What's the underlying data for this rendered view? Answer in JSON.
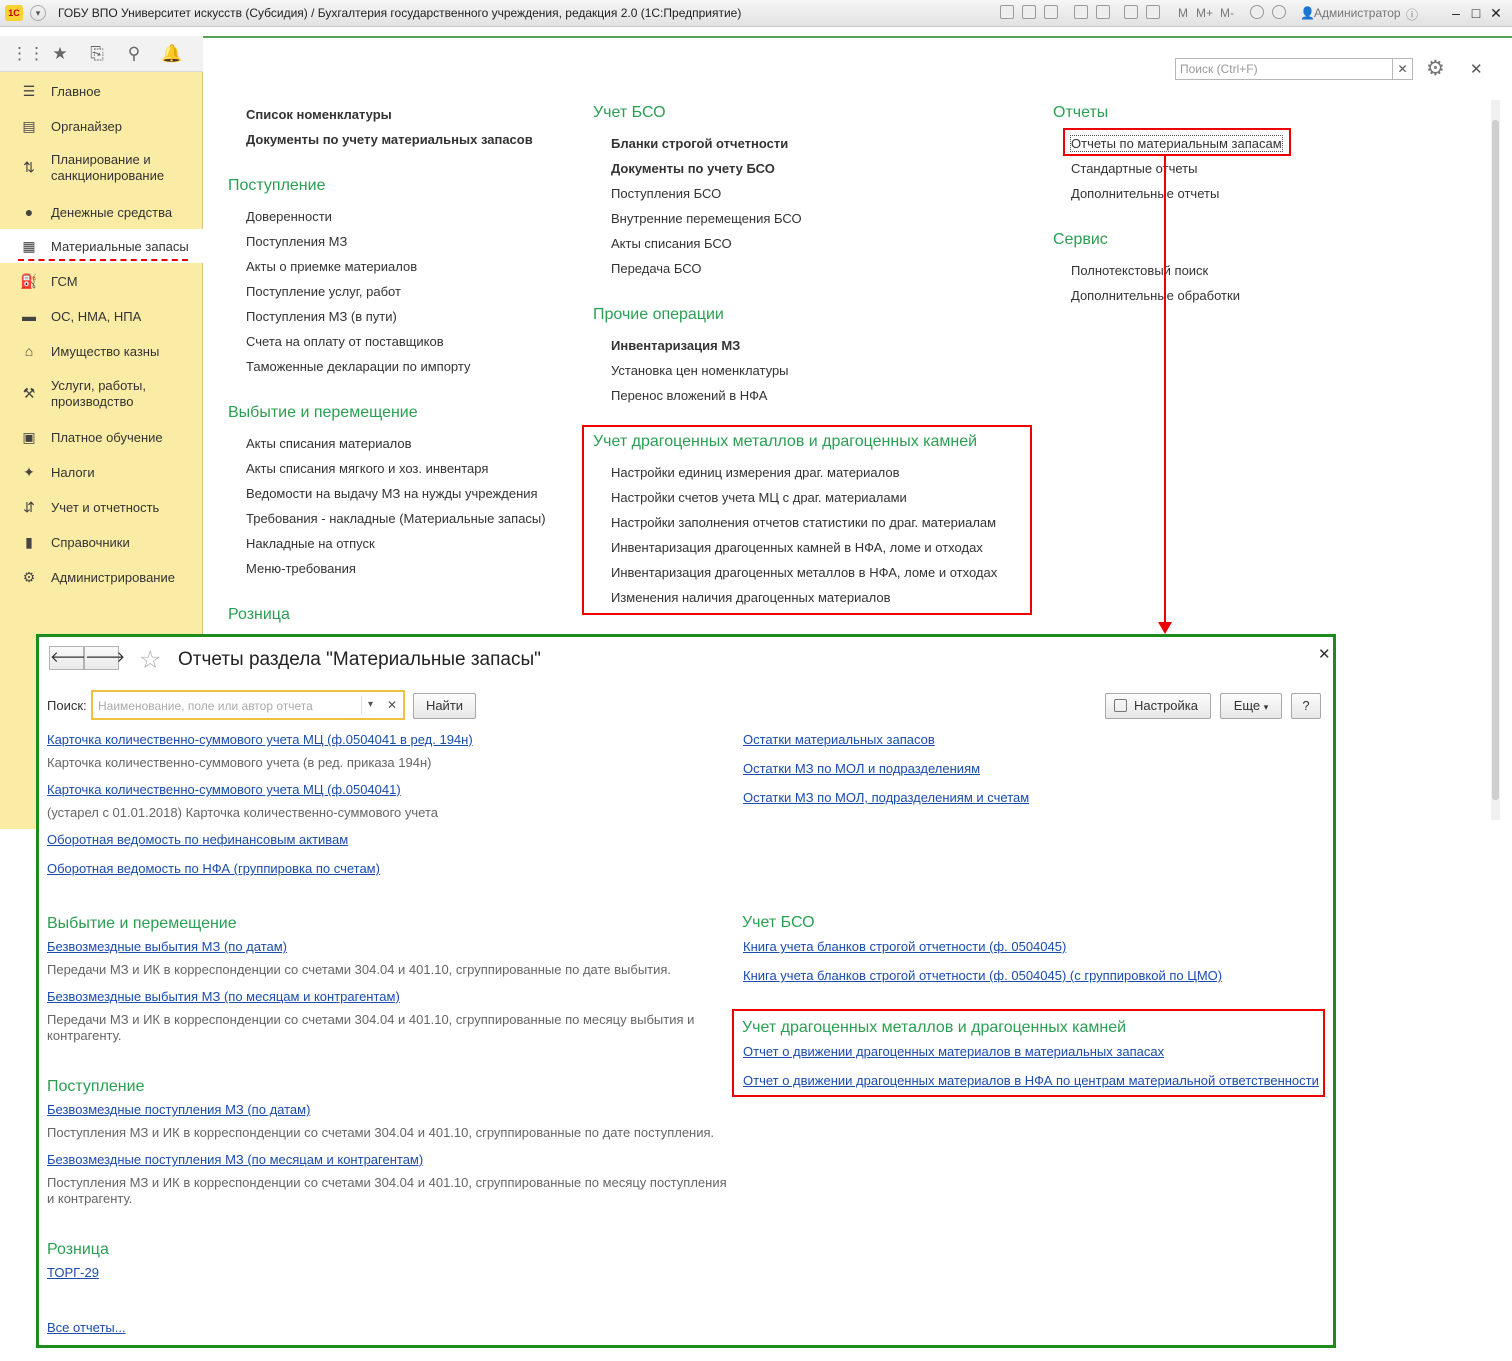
{
  "window": {
    "title": "ГОБУ ВПО Университет искусств (Субсидия) / Бухгалтерия государственного учреждения, редакция 2.0  (1С:Предприятие)",
    "user": "Администратор",
    "toolbar_labels": [
      "M",
      "M+",
      "M-"
    ]
  },
  "sidebar": {
    "items": [
      {
        "label": "Главное",
        "icon": "menu-icon"
      },
      {
        "label": "Органайзер",
        "icon": "organizer-icon"
      },
      {
        "label": "Планирование и\nсанкционирование",
        "icon": "planning-icon"
      },
      {
        "label": "Денежные средства",
        "icon": "money-icon"
      },
      {
        "label": "Материальные запасы",
        "icon": "grid-icon"
      },
      {
        "label": "ГСМ",
        "icon": "fuel-icon"
      },
      {
        "label": "ОС, НМА, НПА",
        "icon": "truck-icon"
      },
      {
        "label": "Имущество казны",
        "icon": "building-icon"
      },
      {
        "label": "Услуги, работы,\nпроизводство",
        "icon": "tools-icon"
      },
      {
        "label": "Платное обучение",
        "icon": "education-icon"
      },
      {
        "label": "Налоги",
        "icon": "eagle-icon"
      },
      {
        "label": "Учет и отчетность",
        "icon": "report-icon"
      },
      {
        "label": "Справочники",
        "icon": "book-icon"
      },
      {
        "label": "Администрирование",
        "icon": "gear-icon"
      }
    ]
  },
  "main": {
    "search_placeholder": "Поиск (Ctrl+F)",
    "col1": {
      "top": [
        "Список номенклатуры",
        "Документы по учету материальных запасов"
      ],
      "h1": "Поступление",
      "g1": [
        "Доверенности",
        "Поступления МЗ",
        "Акты о приемке материалов",
        "Поступление услуг, работ",
        "Поступления МЗ (в пути)",
        "Счета на оплату от поставщиков",
        "Таможенные декларации по импорту"
      ],
      "h2": "Выбытие и перемещение",
      "g2": [
        "Акты списания материалов",
        "Акты списания мягкого и хоз. инвентаря",
        "Ведомости на выдачу МЗ на нужды учреждения",
        "Требования - накладные (Материальные запасы)",
        "Накладные на отпуск",
        "Меню-требования"
      ],
      "h3": "Розница"
    },
    "col2": {
      "h1": "Учет БСО",
      "g1": [
        "Бланки строгой отчетности",
        "Документы по учету БСО",
        "Поступления БСО",
        "Внутренние перемещения БСО",
        "Акты списания БСО",
        "Передача БСО"
      ],
      "h2": "Прочие операции",
      "g2": [
        "Инвентаризация МЗ",
        "Установка цен номенклатуры",
        "Перенос вложений в НФА"
      ],
      "h3": "Учет драгоценных металлов и драгоценных камней",
      "g3": [
        "Настройки единиц измерения драг. материалов",
        "Настройки счетов учета МЦ с драг. материалами",
        "Настройки заполнения отчетов статистики по драг. материалам",
        "Инвентаризация драгоценных камней в НФА, ломе и отходах",
        "Инвентаризация драгоценных металлов в НФА, ломе и отходах",
        "Изменения наличия драгоценных материалов"
      ]
    },
    "col3": {
      "h1": "Отчеты",
      "g1": [
        "Отчеты по материальным запасам",
        "Стандартные отчеты",
        "Дополнительные отчеты"
      ],
      "h2": "Сервис",
      "g2": [
        "Полнотекстовый поиск",
        "Дополнительные обработки"
      ]
    }
  },
  "popup": {
    "title": "Отчеты раздела \"Материальные запасы\"",
    "search_label": "Поиск:",
    "search_placeholder": "Наименование, поле или автор отчета",
    "find_label": "Найти",
    "settings_label": "Настройка",
    "more_label": "Еще",
    "help_label": "?",
    "left": {
      "l1": "Карточка количественно-суммового учета МЦ  (ф.0504041 в ред. 194н)",
      "d1": "Карточка количественно-суммового учета (в ред. приказа 194н)",
      "l2": "Карточка количественно-суммового учета МЦ  (ф.0504041)",
      "d2": "(устарел с 01.01.2018) Карточка количественно-суммового учета",
      "l3": "Оборотная ведомость по нефинансовым активам",
      "l4": "Оборотная ведомость по НФА (группировка по счетам)",
      "h1": "Выбытие и перемещение",
      "l5": "Безвозмездные выбытия МЗ (по датам)",
      "d5": "Передачи МЗ и ИК в корреспонденции со счетами 304.04 и 401.10, сгруппированные по дате выбытия.",
      "l6": "Безвозмездные выбытия МЗ (по месяцам и контрагентам)",
      "d6a": "Передачи МЗ и ИК в корреспонденции со счетами 304.04 и 401.10, сгруппированные по месяцу выбытия и",
      "d6b": "контрагенту.",
      "h2": "Поступление",
      "l7": "Безвозмездные поступления МЗ (по датам)",
      "d7": "Поступления МЗ и ИК в корреспонденции со счетами 304.04 и 401.10, сгруппированные по дате поступления.",
      "l8": "Безвозмездные поступления МЗ (по месяцам и контрагентам)",
      "d8a": "Поступления МЗ и ИК в корреспонденции со счетами 304.04 и 401.10, сгруппированные по месяцу поступления",
      "d8b": "и контрагенту.",
      "h3": "Розница",
      "l9": "ТОРГ-29",
      "all": "Все отчеты..."
    },
    "right": {
      "l1": "Остатки материальных запасов",
      "l2": "Остатки МЗ по МОЛ и подразделениям",
      "l3": "Остатки МЗ по МОЛ, подразделениям и счетам",
      "h1": "Учет БСО",
      "l4": "Книга учета бланков строгой отчетности (ф. 0504045)",
      "l5": "Книга учета бланков строгой отчетности (ф. 0504045) (с группировкой по ЦМО)",
      "h2": "Учет драгоценных металлов и драгоценных камней",
      "l6": "Отчет о движении драгоценных материалов в материальных запасах",
      "l7": "Отчет о движении драгоценных материалов в НФА по центрам материальной ответственности"
    }
  }
}
